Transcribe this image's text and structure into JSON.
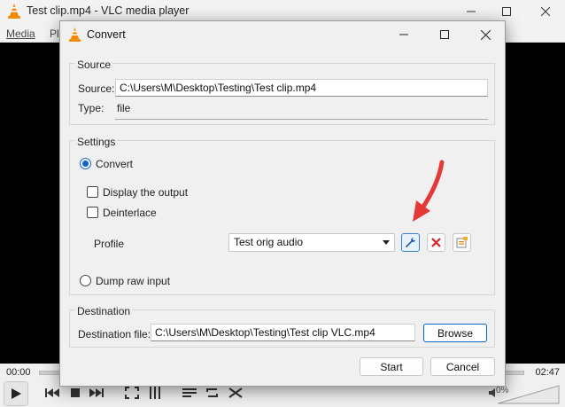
{
  "vlc": {
    "title": "Test clip.mp4 - VLC media player",
    "menu_media": "Media",
    "menu_playback_partial": "Pl",
    "time_elapsed": "00:00",
    "time_total": "02:47",
    "volume": "0%"
  },
  "dialog": {
    "title": "Convert",
    "source": {
      "group_title": "Source",
      "source_label": "Source:",
      "source_value": "C:\\Users\\M\\Desktop\\Testing\\Test clip.mp4",
      "type_label": "Type:",
      "type_value": "file"
    },
    "settings": {
      "group_title": "Settings",
      "convert_label": "Convert",
      "convert_selected": true,
      "display_output_label": "Display the output",
      "deinterlace_label": "Deinterlace",
      "profile_label": "Profile",
      "profile_value": "Test orig audio",
      "dump_raw_label": "Dump raw input"
    },
    "destination": {
      "group_title": "Destination",
      "file_label": "Destination file:",
      "file_value": "C:\\Users\\M\\Desktop\\Testing\\Test clip VLC.mp4",
      "browse_label": "Browse"
    },
    "start_label": "Start",
    "cancel_label": "Cancel"
  },
  "colors": {
    "accent": "#0a64d6",
    "delete_red": "#d6202a",
    "annotation_red": "#e53935",
    "vlc_orange": "#f08a00"
  }
}
